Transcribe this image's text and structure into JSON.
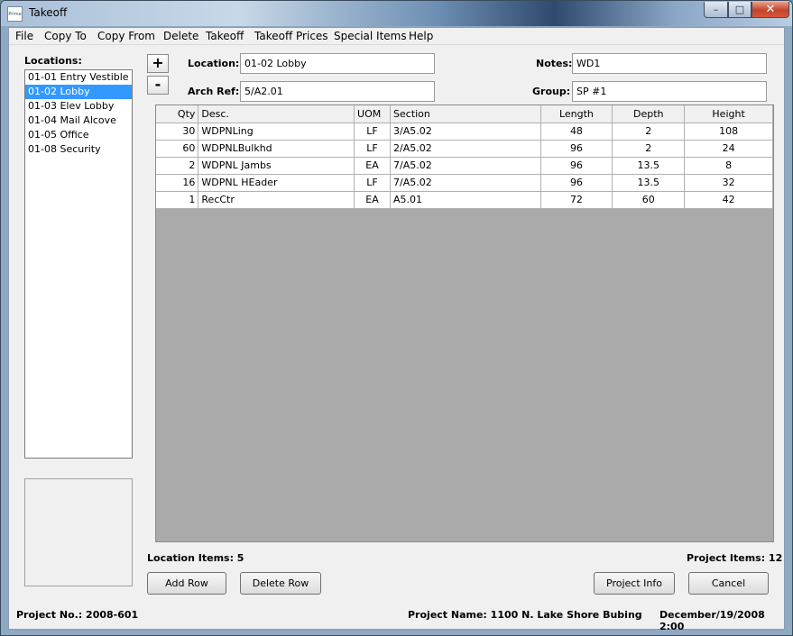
{
  "window": {
    "title": "Takeoff",
    "app_icon_text": "Prime"
  },
  "menu": [
    "File",
    "Copy To",
    "Copy From",
    "Delete",
    "Takeoff",
    "Takeoff Prices",
    "Special Items",
    "Help"
  ],
  "locations": {
    "label": "Locations:",
    "items": [
      "01-01 Entry Vestible",
      "01-02 Lobby",
      "01-03 Elev Lobby",
      "01-04 Mail Alcove",
      "01-05 Office",
      "01-08 Security"
    ],
    "selected": "01-02 Lobby"
  },
  "controls": {
    "plus": "+",
    "minus": "-"
  },
  "form": {
    "location_label": "Location:",
    "location_value": "01-02 Lobby",
    "archref_label": "Arch Ref:",
    "archref_value": "5/A2.01",
    "notes_label": "Notes:",
    "notes_value": "WD1",
    "group_label": "Group:",
    "group_value": "SP #1"
  },
  "table": {
    "columns": [
      "Qty",
      "Desc.",
      "UOM",
      "Section",
      "Length",
      "Depth",
      "Height"
    ],
    "rows": [
      [
        "30",
        "WDPNLing",
        "LF",
        "3/A5.02",
        "48",
        "2",
        "108"
      ],
      [
        "60",
        "WDPNLBulkhd",
        "LF",
        "2/A5.02",
        "96",
        "2",
        "24"
      ],
      [
        "2",
        "WDPNL Jambs",
        "EA",
        "7/A5.02",
        "96",
        "13.5",
        "8"
      ],
      [
        "16",
        "WDPNL HEader",
        "LF",
        "7/A5.02",
        "96",
        "13.5",
        "32"
      ],
      [
        "1",
        "RecCtr",
        "EA",
        "A5.01",
        "72",
        "60",
        "42"
      ]
    ]
  },
  "summary": {
    "location_items": "Location Items: 5",
    "project_items": "Project Items: 12"
  },
  "buttons": {
    "add_row": "Add Row",
    "delete_row": "Delete Row",
    "project_info": "Project Info",
    "cancel": "Cancel"
  },
  "status": {
    "project_no": "Project No.: 2008-601",
    "project_name": "Project Name: 1100 N. Lake Shore Bubing",
    "datetime": "December/19/2008 2:00"
  },
  "colors": {
    "selection": "#3399ff",
    "grid_empty": "#aaaaaa",
    "face": "#f0f0f0"
  }
}
